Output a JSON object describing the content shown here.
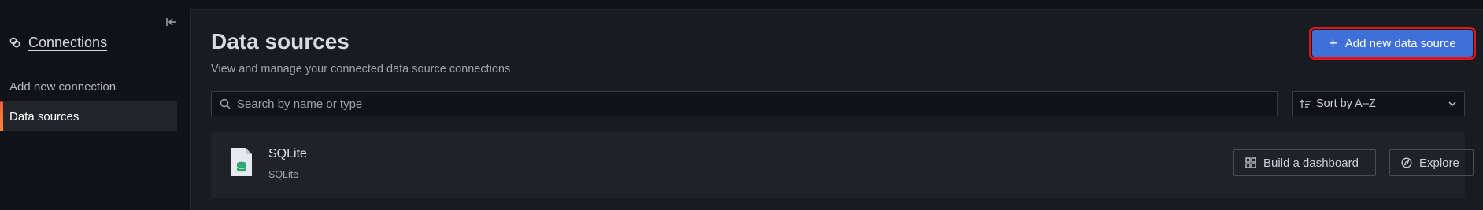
{
  "sidebar": {
    "title": "Connections",
    "title_icon": "connections-icon",
    "collapse_icon": "collapse-left-icon",
    "items": [
      {
        "label": "Add new connection",
        "active": false
      },
      {
        "label": "Data sources",
        "active": true
      }
    ]
  },
  "main": {
    "title": "Data sources",
    "subtitle": "View and manage your connected data source connections",
    "add_button": {
      "label": "Add new data source",
      "icon": "plus-icon"
    },
    "search": {
      "placeholder": "Search by name or type",
      "value": ""
    },
    "sort": {
      "label": "Sort by A–Z",
      "icon": "sort-icon"
    },
    "datasources": [
      {
        "name": "SQLite",
        "type": "SQLite",
        "icon": "sqlite-file-icon",
        "actions": [
          {
            "label": "Build a dashboard",
            "icon": "dashboard-grid-icon"
          },
          {
            "label": "Explore",
            "icon": "compass-icon"
          }
        ]
      }
    ]
  },
  "colors": {
    "background": "#111217",
    "panel": "#181b1f",
    "card": "#202227",
    "primary": "#3d71d9",
    "highlight_outline": "#e0141a",
    "active_accent": "#f55f3e",
    "sqlite_green": "#2fa56f"
  }
}
